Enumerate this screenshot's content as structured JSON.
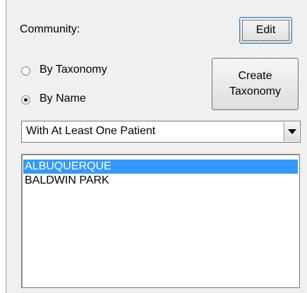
{
  "community": {
    "label": "Community:",
    "edit_label": "Edit"
  },
  "mode": {
    "options": [
      {
        "label": "By Taxonomy",
        "selected": false
      },
      {
        "label": "By Name",
        "selected": true
      }
    ]
  },
  "create_taxonomy": {
    "line1": "Create",
    "line2": "Taxonomy"
  },
  "filter": {
    "selected": "With At Least One Patient"
  },
  "list": {
    "items": [
      {
        "label": "ALBUQUERQUE",
        "selected": true
      },
      {
        "label": "BALDWIN PARK",
        "selected": false
      }
    ]
  },
  "colors": {
    "selection": "#3399ff",
    "panel": "#f0f0f0"
  }
}
